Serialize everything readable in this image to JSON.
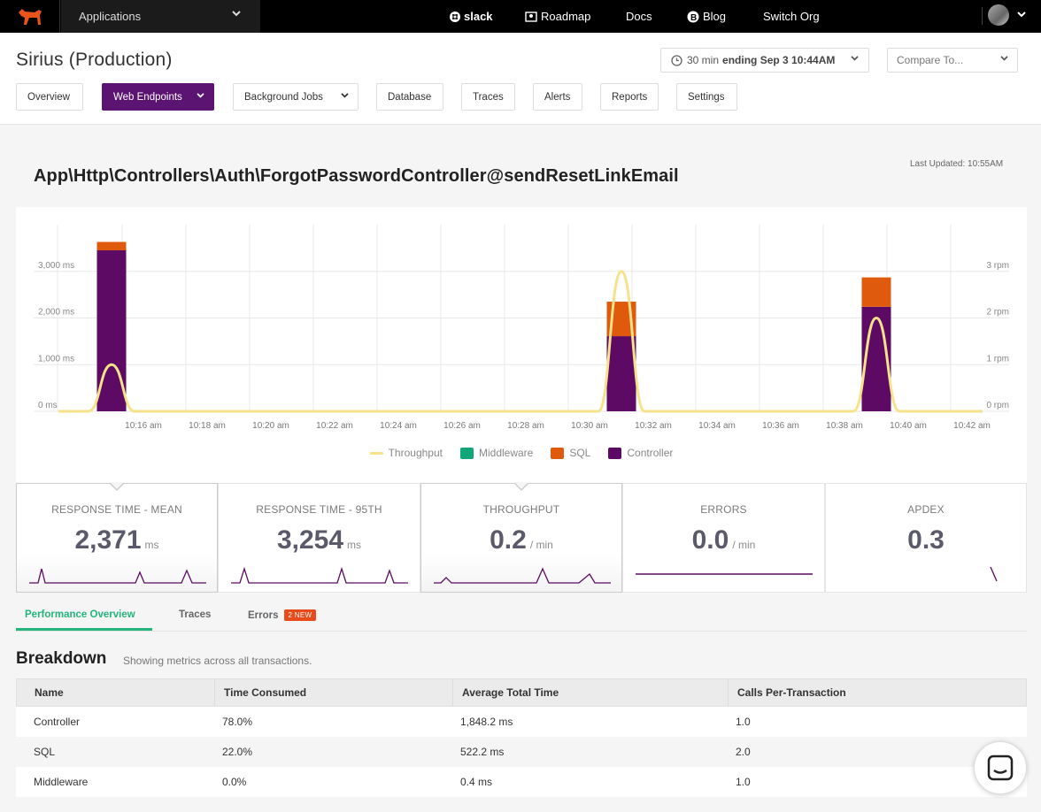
{
  "topbar": {
    "app_selector": "Applications",
    "nav": [
      {
        "label": "slack",
        "icon": "slack-icon"
      },
      {
        "label": "Roadmap",
        "icon": "map-pin-icon"
      },
      {
        "label": "Docs"
      },
      {
        "label": "Blog",
        "icon": "blog-icon"
      },
      {
        "label": "Switch Org"
      }
    ]
  },
  "header": {
    "title": "Sirius (Production)",
    "time_range": {
      "prefix": "30 min",
      "bold": "ending Sep 3 10:44AM"
    },
    "compare_placeholder": "Compare To...",
    "tabs": [
      "Overview",
      "Web Endpoints",
      "Background Jobs",
      "Database",
      "Traces",
      "Alerts",
      "Reports",
      "Settings"
    ],
    "active_tab": "Web Endpoints"
  },
  "endpoint": {
    "title": "App\\Http\\Controllers\\Auth\\ForgotPasswordController@sendResetLinkEmail",
    "last_updated": "Last Updated: 10:55AM"
  },
  "chart_data": {
    "type": "bar",
    "title": "",
    "x_labels": [
      "10:16 am",
      "10:18 am",
      "10:20 am",
      "10:22 am",
      "10:24 am",
      "10:26 am",
      "10:28 am",
      "10:30 am",
      "10:32 am",
      "10:34 am",
      "10:36 am",
      "10:38 am",
      "10:40 am",
      "10:42 am"
    ],
    "y_left": {
      "ticks": [
        "0 ms",
        "1,000 ms",
        "2,000 ms",
        "3,000 ms"
      ],
      "ylim": [
        0,
        4000
      ]
    },
    "y_right": {
      "ticks": [
        "0 rpm",
        "1 rpm",
        "2 rpm",
        "3 rpm"
      ],
      "ylim": [
        0,
        4
      ]
    },
    "bars": [
      {
        "x": "10:15 am",
        "Controller": 3450,
        "SQL": 180,
        "Middleware": 0
      },
      {
        "x": "10:31 am",
        "Controller": 1610,
        "SQL": 740,
        "Middleware": 0
      },
      {
        "x": "10:39 am",
        "Controller": 2240,
        "SQL": 630,
        "Middleware": 0
      }
    ],
    "throughput": {
      "name": "Throughput",
      "peaks": [
        {
          "x": "10:15 am",
          "rpm": 1
        },
        {
          "x": "10:31 am",
          "rpm": 3
        },
        {
          "x": "10:39 am",
          "rpm": 2
        }
      ]
    },
    "legend": [
      {
        "label": "Throughput",
        "color": "#f5e28a",
        "kind": "line"
      },
      {
        "label": "Middleware",
        "color": "#11a57a",
        "kind": "box"
      },
      {
        "label": "SQL",
        "color": "#e05a0d",
        "kind": "box"
      },
      {
        "label": "Controller",
        "color": "#5c0a63",
        "kind": "box"
      }
    ],
    "grid": true
  },
  "metrics": [
    {
      "title": "RESPONSE TIME - MEAN",
      "value": "2,371",
      "unit": "ms",
      "selected": true
    },
    {
      "title": "RESPONSE TIME - 95TH",
      "value": "3,254",
      "unit": "ms",
      "selected": false
    },
    {
      "title": "THROUGHPUT",
      "value": "0.2",
      "unit": "/ min",
      "selected": true
    },
    {
      "title": "ERRORS",
      "value": "0.0",
      "unit": "/ min",
      "selected": false
    },
    {
      "title": "APDEX",
      "value": "0.3",
      "unit": "",
      "selected": false
    }
  ],
  "subtabs": {
    "items": [
      "Performance Overview",
      "Traces",
      "Errors"
    ],
    "errors_badge": "2 NEW"
  },
  "breakdown": {
    "title": "Breakdown",
    "subtitle": "Showing metrics across all transactions.",
    "columns": [
      "Name",
      "Time Consumed",
      "Average Total Time",
      "Calls Per-Transaction"
    ],
    "rows": [
      [
        "Controller",
        "78.0%",
        "1,848.2 ms",
        "1.0"
      ],
      [
        "SQL",
        "22.0%",
        "522.2 ms",
        "2.0"
      ],
      [
        "Middleware",
        "0.0%",
        "0.4 ms",
        "1.0"
      ]
    ]
  },
  "colors": {
    "accent": "#5c1473",
    "green": "#23b57b",
    "controller": "#5c0a63",
    "sql": "#e05a0d",
    "middleware": "#11a57a",
    "throughput": "#f5e28a"
  }
}
